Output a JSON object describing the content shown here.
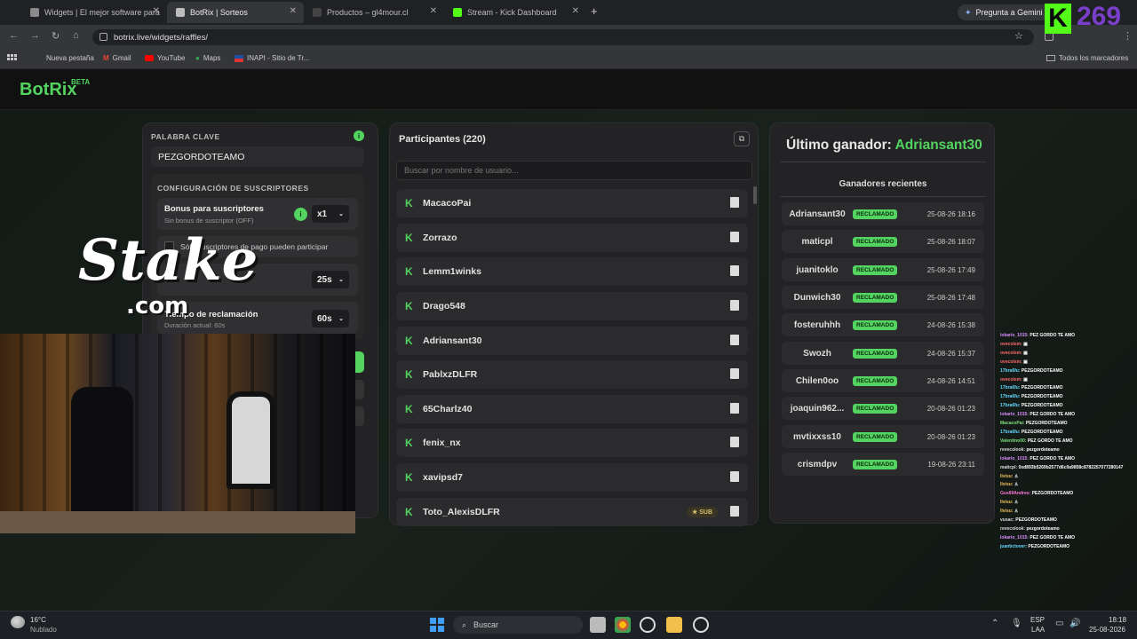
{
  "browser": {
    "tabs": [
      {
        "label": "Widgets | El mejor software para"
      },
      {
        "label": "BotRix | Sorteos"
      },
      {
        "label": "Productos – gl4mour.cl"
      },
      {
        "label": "Stream - Kick Dashboard"
      }
    ],
    "new_tab": "+",
    "gemini": "Pregunta a Gemini",
    "url": "botrix.live/widgets/raffles/",
    "bookmarks": [
      "Nueva pestaña",
      "Gmail",
      "YouTube",
      "Maps",
      "INAPI - Sitio de Tr..."
    ],
    "all_bookmarks": "Todos los marcadores"
  },
  "overlay": {
    "kick_k": "K",
    "counter": "269",
    "stake_1": "Stake",
    "stake_2": ".com"
  },
  "app": {
    "logo": "BotRix",
    "beta": "BETA"
  },
  "settings": {
    "keyword_label": "PALABRA CLAVE",
    "keyword_value": "PEZGORDOTEAMO",
    "sub_config_label": "CONFIGURACIÓN DE SUSCRIPTORES",
    "bonus_title": "Bonus para suscriptores",
    "bonus_sub": "Sin bonus de suscriptor (OFF)",
    "bonus_value": "x1",
    "paid_only": "Sólo suscriptores de pago pueden participar",
    "timer_value": "25s",
    "claim_title": "Tiempo de reclamación",
    "claim_sub": "Duración actual: 60s",
    "claim_value": "60s"
  },
  "participants": {
    "title": "Participantes (220)",
    "search_placeholder": "Buscar por nombre de usuario...",
    "sub_badge": "SUB",
    "list": [
      "MacacoPai",
      "Zorrazo",
      "Lemm1winks",
      "Drago548",
      "Adriansant30",
      "PablxzDLFR",
      "65Charlz40",
      "fenix_nx",
      "xavipsd7",
      "Toto_AlexisDLFR"
    ]
  },
  "winners": {
    "title_prefix": "Último ganador:",
    "last_winner": "Adriansant30",
    "recent_label": "Ganadores recientes",
    "badge": "RECLAMADO",
    "list": [
      {
        "name": "Adriansant30",
        "date": "25-08-26 18:16"
      },
      {
        "name": "maticpl",
        "date": "25-08-26 18:07"
      },
      {
        "name": "juanitoklo",
        "date": "25-08-26 17:49"
      },
      {
        "name": "Dunwich30",
        "date": "25-08-26 17:48"
      },
      {
        "name": "fosteruhhh",
        "date": "24-08-26 15:38"
      },
      {
        "name": "Swozh",
        "date": "24-08-26 15:37"
      },
      {
        "name": "Chilen0oo",
        "date": "24-08-26 14:51"
      },
      {
        "name": "joaquin962...",
        "date": "20-08-26 01:23"
      },
      {
        "name": "mvtixxss10",
        "date": "20-08-26 01:23"
      },
      {
        "name": "crismdpv",
        "date": "19-08-26 23:11"
      }
    ]
  },
  "chat": [
    {
      "user": "lokario_1015:",
      "msg": "PEZ GORDO TE AMO",
      "color": "#d98cff"
    },
    {
      "user": "ovecolsm:",
      "msg": "▣",
      "color": "#ff6b6b"
    },
    {
      "user": "ovecolsm:",
      "msg": "▣",
      "color": "#ff6b6b"
    },
    {
      "user": "ovecolsm:",
      "msg": "▣",
      "color": "#ff6b6b"
    },
    {
      "user": "17bra6fu:",
      "msg": "PEZGORDOTEAMO",
      "color": "#66d9ff"
    },
    {
      "user": "ovecolsm:",
      "msg": "▣",
      "color": "#ff6b6b"
    },
    {
      "user": "17bra6fu:",
      "msg": "PEZGORDOTEAMO",
      "color": "#66d9ff"
    },
    {
      "user": "17bra6fu:",
      "msg": "PEZGORDOTEAMO",
      "color": "#66d9ff"
    },
    {
      "user": "17bra6fu:",
      "msg": "PEZGORDOTEAMO",
      "color": "#66d9ff"
    },
    {
      "user": "lokario_1015:",
      "msg": "PEZ GORDO TE AMO",
      "color": "#d98cff"
    },
    {
      "user": "MacacoPai:",
      "msg": "PEZGORDOTEAMO",
      "color": "#7ee07e"
    },
    {
      "user": "17bra6fu:",
      "msg": "PEZGORDOTEAMO",
      "color": "#66d9ff"
    },
    {
      "user": "Valentino00:",
      "msg": "PEZ GORDO TE AMO",
      "color": "#7ee07e"
    },
    {
      "user": "revecolook:",
      "msg": "pezgordoteamo",
      "color": "#dddddd"
    },
    {
      "user": "lokario_1015:",
      "msg": "PEZ GORDO TE AMO",
      "color": "#d98cff"
    },
    {
      "user": "maticpl:",
      "msg": "0xd893b5269b2577d6c0a9858c8782257077280147",
      "color": "#dddddd"
    },
    {
      "user": "llvisu:",
      "msg": "♙",
      "color": "#f0c05a"
    },
    {
      "user": "llvisu:",
      "msg": "♙",
      "color": "#f0c05a"
    },
    {
      "user": "Gus69Andres:",
      "msg": "PEZGORDOTEAMO",
      "color": "#ff7ad9"
    },
    {
      "user": "llvisu:",
      "msg": "♙",
      "color": "#f0c05a"
    },
    {
      "user": "llvisu:",
      "msg": "♙",
      "color": "#f0c05a"
    },
    {
      "user": "vusac:",
      "msg": "PEZGORDOTEAMO",
      "color": "#dddddd"
    },
    {
      "user": "revecolook:",
      "msg": "pezgordoteamo",
      "color": "#dddddd"
    },
    {
      "user": "lokario_1015:",
      "msg": "PEZ GORDO TE AMO",
      "color": "#d98cff"
    },
    {
      "user": "juanbctover:",
      "msg": "PEZGORDOTEAMO",
      "color": "#66d9ff"
    }
  ],
  "taskbar": {
    "temp": "16°C",
    "weather": "Nublado",
    "search": "Buscar",
    "lang_1": "ESP",
    "lang_2": "LAA",
    "time": "18:18",
    "date": "25-08-2026"
  },
  "colors": {
    "accent": "#53d35f",
    "kick_green": "#53fc18",
    "overlay_purple": "#7a3fc9"
  }
}
